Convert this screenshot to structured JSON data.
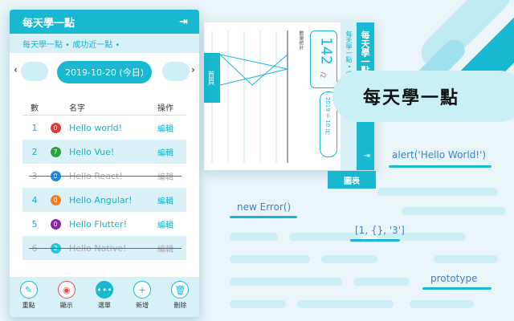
{
  "app": {
    "title": "每天學一點",
    "subtitle": "每天學一點 • 成功近一點 •"
  },
  "date_nav": {
    "prev": "‹",
    "next": "›",
    "current": "2019-10-20 (今日)"
  },
  "table": {
    "headers": {
      "num": "數",
      "name": "名字",
      "op": "操作"
    },
    "rows": [
      {
        "idx": "1",
        "badge": "0",
        "badge_color": "#e53935",
        "name": "Hello world!",
        "op": "編輯",
        "done": false
      },
      {
        "idx": "2",
        "badge": "7",
        "badge_color": "#26a641",
        "name": "Hello Vue!",
        "op": "編輯",
        "done": false
      },
      {
        "idx": "3",
        "badge": "0",
        "badge_color": "#1e88e5",
        "name": "Hello React!",
        "op": "編輯",
        "done": true
      },
      {
        "idx": "4",
        "badge": "0",
        "badge_color": "#f57c22",
        "name": "Hello Angular!",
        "op": "編輯",
        "done": false
      },
      {
        "idx": "5",
        "badge": "0",
        "badge_color": "#8e24aa",
        "name": "Hello Flutter!",
        "op": "編輯",
        "done": false
      },
      {
        "idx": "6",
        "badge": "2",
        "badge_color": "#26c6da",
        "name": "Hello Native!",
        "op": "編輯",
        "done": true
      }
    ]
  },
  "bottom_bar": [
    {
      "label": "重點",
      "icon": "pencil-icon"
    },
    {
      "label": "顯示",
      "icon": "eye-icon"
    },
    {
      "label": "選單",
      "icon": "more-icon"
    },
    {
      "label": "新增",
      "icon": "plus-icon"
    },
    {
      "label": "刪除",
      "icon": "trash-icon"
    }
  ],
  "screen2": {
    "title": "每天學一點",
    "subtitle": "每天學一點 • 成功近一點 •",
    "count": "142",
    "count_total": "/2",
    "date": "2019 = 10 月",
    "home_label": "首頁",
    "tab_label": "圖表",
    "chart_label": "數量統計"
  },
  "banner": {
    "text": "每天學一點"
  },
  "code_snippets": {
    "alert": "alert('Hello World!')",
    "error": "new Error()",
    "array": "[1, {}, '3']",
    "proto": "prototype"
  },
  "colors": {
    "accent": "#18b8d1",
    "light": "#d8f1f6"
  }
}
